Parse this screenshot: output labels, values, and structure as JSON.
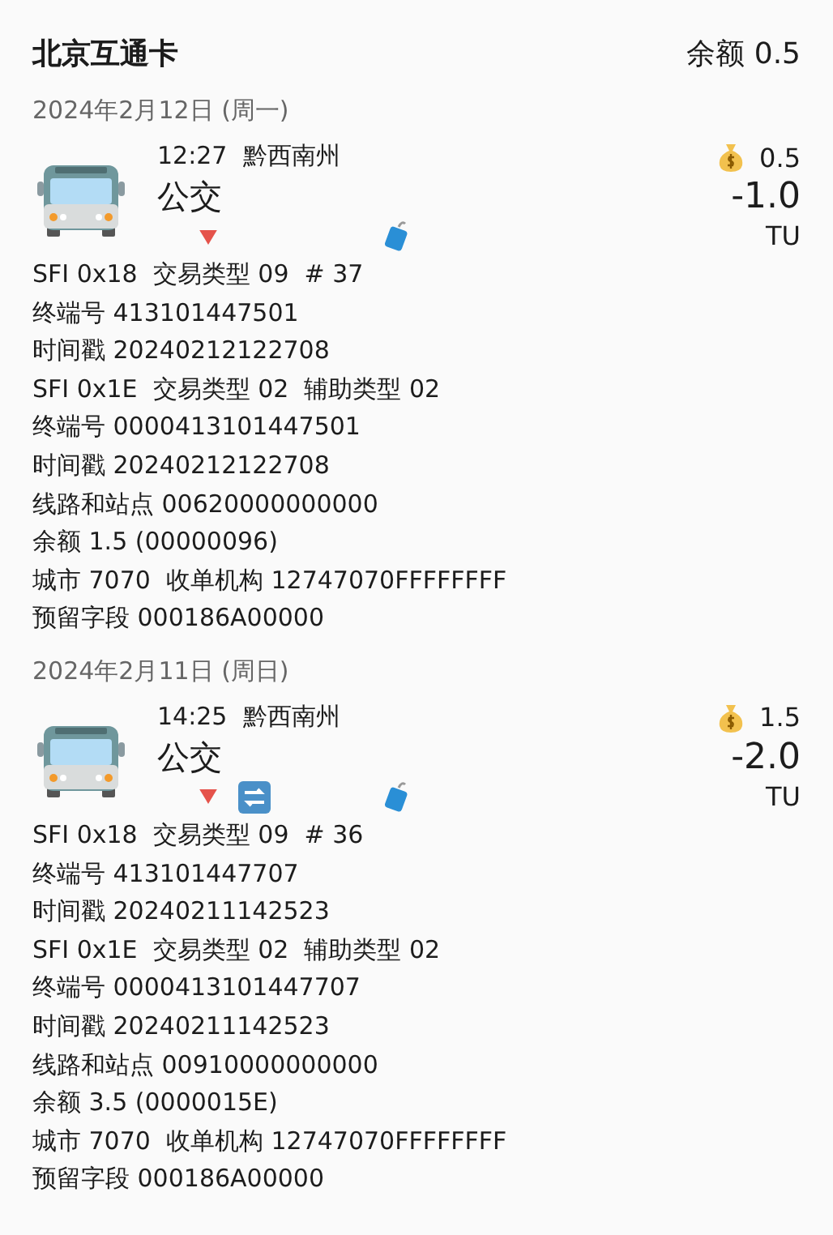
{
  "header": {
    "title": "北京互通卡",
    "balance": "余额 0.5"
  },
  "days": [
    {
      "date": "2024年2月12日 (周一)",
      "records": [
        {
          "time": "12:27",
          "place": "黔西南州",
          "type": "公交",
          "balance_after": "0.5",
          "amount": "-1.0",
          "unit": "TU",
          "flags": {
            "debit": true,
            "transfer": false,
            "luggage": true
          },
          "lines": [
            "SFI 0x18  交易类型 09  # 37",
            "终端号 413101447501",
            "时间戳 20240212122708",
            "SFI 0x1E  交易类型 02  辅助类型 02",
            "终端号 0000413101447501",
            "时间戳 20240212122708",
            "线路和站点 00620000000000",
            "余额 1.5 (00000096)",
            "城市 7070  收单机构 12747070FFFFFFFF",
            "预留字段 000186A00000"
          ]
        }
      ]
    },
    {
      "date": "2024年2月11日 (周日)",
      "records": [
        {
          "time": "14:25",
          "place": "黔西南州",
          "type": "公交",
          "balance_after": "1.5",
          "amount": "-2.0",
          "unit": "TU",
          "flags": {
            "debit": true,
            "transfer": true,
            "luggage": true
          },
          "lines": [
            "SFI 0x18  交易类型 09  # 36",
            "终端号 413101447707",
            "时间戳 20240211142523",
            "SFI 0x1E  交易类型 02  辅助类型 02",
            "终端号 0000413101447707",
            "时间戳 20240211142523",
            "线路和站点 00910000000000",
            "余额 3.5 (0000015E)",
            "城市 7070  收单机构 12747070FFFFFFFF",
            "预留字段 000186A00000"
          ]
        }
      ]
    }
  ]
}
